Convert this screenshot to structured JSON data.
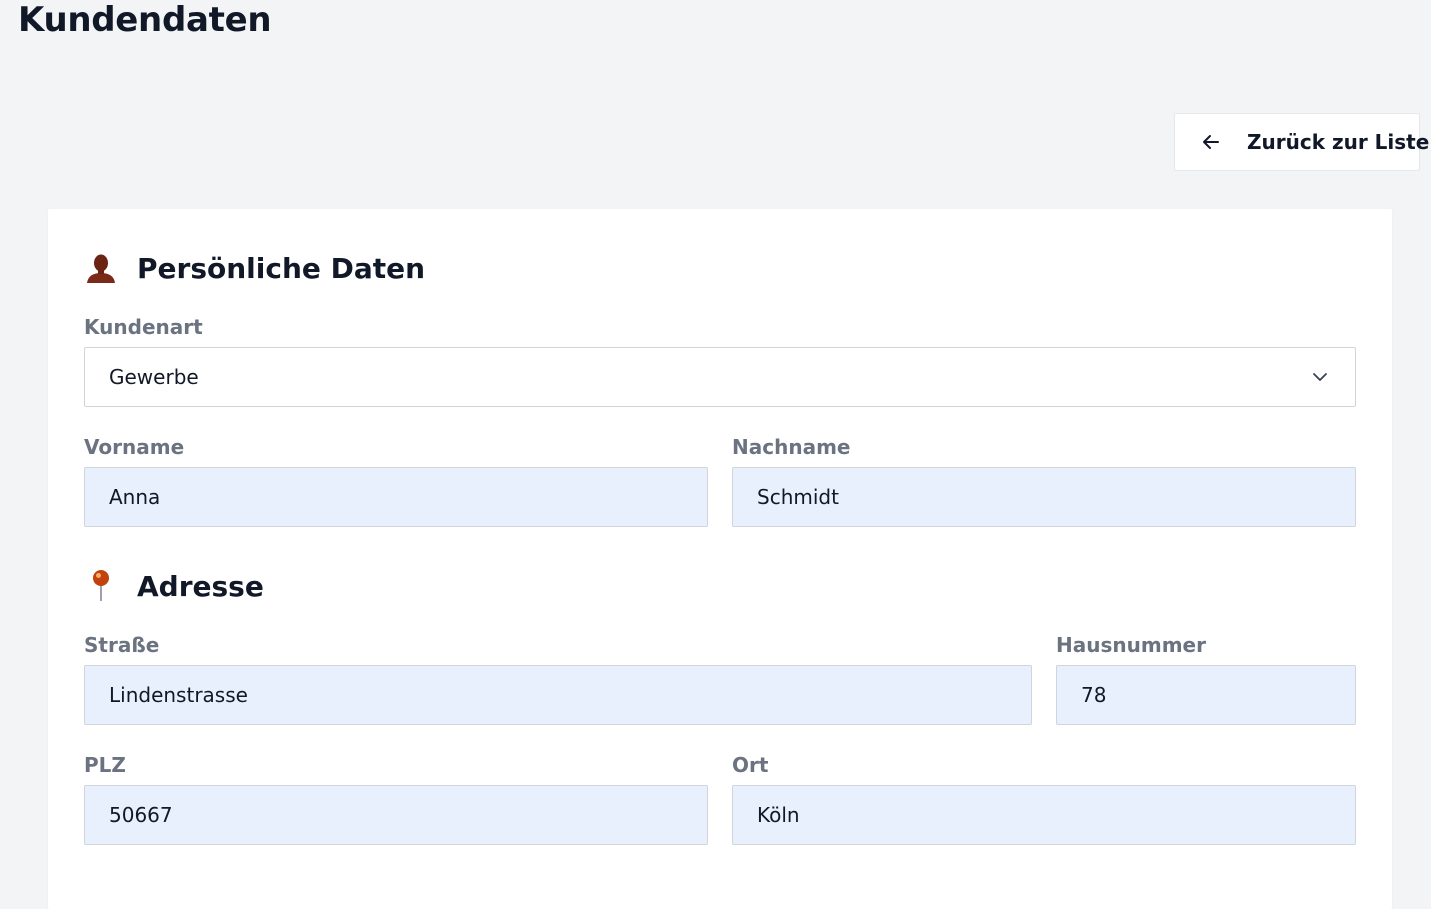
{
  "page": {
    "title": "Kundendaten",
    "back_button_label": "Zurück zur Liste"
  },
  "personal": {
    "title": "Persönliche Daten",
    "icon": "person-icon",
    "customer_type": {
      "label": "Kundenart",
      "value": "Gewerbe"
    },
    "first_name": {
      "label": "Vorname",
      "value": "Anna"
    },
    "last_name": {
      "label": "Nachname",
      "value": "Schmidt"
    }
  },
  "address": {
    "title": "Adresse",
    "icon": "pushpin-icon",
    "street": {
      "label": "Straße",
      "value": "Lindenstrasse"
    },
    "house_number": {
      "label": "Hausnummer",
      "value": "78"
    },
    "zip": {
      "label": "PLZ",
      "value": "50667"
    },
    "city": {
      "label": "Ort",
      "value": "Köln"
    }
  },
  "colors": {
    "background": "#f3f4f6",
    "card": "#ffffff",
    "autofill_field": "#e8f0fe",
    "label": "#6b7280",
    "text": "#111827"
  }
}
